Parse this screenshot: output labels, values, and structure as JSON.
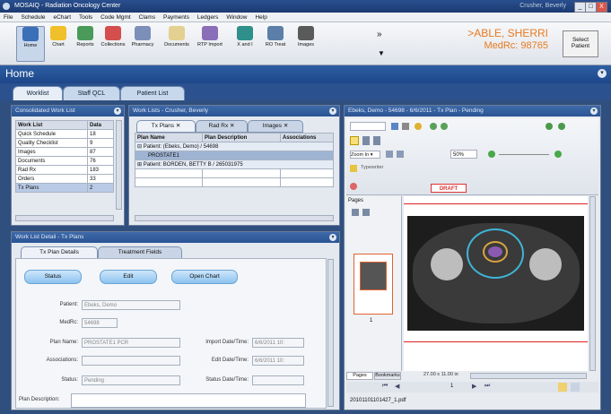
{
  "window": {
    "title": "MOSAIQ - Radiation Oncology Center",
    "right_user": "Crusher, Beverly",
    "min": "_",
    "max": "□",
    "close": "X"
  },
  "menu": [
    "File",
    "Schedule",
    "eChart",
    "Tools",
    "Code Mgmt",
    "Clams",
    "Payments",
    "Ledgers",
    "Window",
    "Help"
  ],
  "toolbar": {
    "buttons": [
      {
        "label": "Home",
        "icon": "home-icon"
      },
      {
        "label": "Chart",
        "icon": "chart-icon"
      },
      {
        "label": "Reports",
        "icon": "reports-icon"
      },
      {
        "label": "Collections",
        "icon": "collections-icon"
      },
      {
        "label": "Pharmacy",
        "icon": "pharmacy-icon"
      },
      {
        "label": "Documents",
        "icon": "documents-icon"
      },
      {
        "label": "RTP Import",
        "icon": "rtp-import-icon"
      },
      {
        "label": "X and I",
        "icon": "x-and-i-icon"
      },
      {
        "label": "RO Treat",
        "icon": "ro-treat-icon"
      },
      {
        "label": "Images",
        "icon": "images-icon"
      }
    ],
    "overflow": "»"
  },
  "patient": {
    "name": ">ABLE, SHERRI",
    "mrn": "MedRc: 98765",
    "select_label": "Select Patient"
  },
  "home": {
    "title": "Home"
  },
  "main_tabs": [
    "Worklist",
    "Staff QCL",
    "Patient List"
  ],
  "consolidated": {
    "title": "Consolidated Work List",
    "headers": [
      "Work List",
      "Data"
    ],
    "rows": [
      [
        "Quick Schedule",
        "18"
      ],
      [
        "Quality Checklist",
        "9"
      ],
      [
        "Images",
        "87"
      ],
      [
        "Documents",
        "76"
      ],
      [
        "Rad Rx",
        "183"
      ],
      [
        "Orders",
        "33"
      ],
      [
        "Tx Plans",
        "2"
      ]
    ]
  },
  "worklists": {
    "title": "Work Lists - Crusher, Beverly",
    "tabs": [
      "Tx Plans",
      "Rad Rx",
      "Images"
    ],
    "headers": [
      "Plan Name",
      "Plan Description",
      "Associations"
    ],
    "rows": [
      "Patient: (Ebeks, Demo) / 54698",
      "PROSTATE1",
      "Patient: BORDEN, BETTY B / 265031975"
    ]
  },
  "detail": {
    "title": "Work List Detail - Tx Plans",
    "tabs": [
      "Tx Plan Details",
      "Treatment Fields"
    ],
    "buttons": [
      "Status",
      "Edit",
      "Open Chart"
    ],
    "fields": {
      "patient_label": "Patient:",
      "patient_value": "Ebeks, Demo",
      "medrc_label": "MedRc:",
      "medrc_value": "54698",
      "plan_name_label": "Plan Name:",
      "plan_name_value": "PROSTATE1 PCR",
      "assoc_label": "Associations:",
      "assoc_value": "",
      "status_label": "Status:",
      "status_value": "Pending",
      "plan_desc_label": "Plan Description:",
      "import_label": "Import Date/Time:",
      "import_value": "6/6/2011 10:",
      "edit_label": "Edit Date/Time:",
      "edit_value": "6/6/2011 10:",
      "status_dt_label": "Status Date/Time:",
      "status_dt_value": ""
    }
  },
  "viewer": {
    "title": "Ebeks, Demo - 54698 - 6/6/2011 - Tx Plan - Pending",
    "zoom": "50%",
    "draft": "DRAFT",
    "pages_label": "Pages",
    "bottom_tabs": [
      "Pages",
      "Bookmarks"
    ],
    "page_size": "27.00 x 11.00 in",
    "page_index": "1",
    "filename": "20101101101427_1.pdf"
  }
}
